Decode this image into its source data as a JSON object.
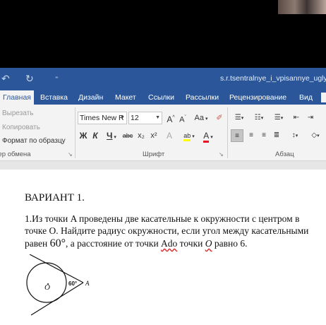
{
  "window": {
    "doc_title": "s.r.tsentralnye_i_vpisannye_ugly"
  },
  "tabs": [
    "Главная",
    "Вставка",
    "Дизайн",
    "Макет",
    "Ссылки",
    "Рассылки",
    "Рецензирование",
    "Вид"
  ],
  "clipboard": {
    "cut": "Вырезать",
    "copy": "Копировать",
    "format_painter": "Формат по образцу",
    "group_label": "Буфер обмена"
  },
  "font": {
    "name": "Times New R",
    "size": "12",
    "grow": "A",
    "shrink": "A",
    "case": "Aa",
    "bold": "Ж",
    "italic": "К",
    "underline": "Ч",
    "strike": "abc",
    "subscript": "x₂",
    "superscript": "x²",
    "text_effects": "A",
    "highlight": "ab",
    "font_color": "A",
    "group_label": "Шрифт"
  },
  "paragraph": {
    "group_label": "Абзац"
  },
  "colors": {
    "accent": "#2b579a",
    "highlight": "#ffff00",
    "font_color": "#e81123"
  },
  "document": {
    "variant": "ВАРИАНТ 1.",
    "problem_lines": [
      "1.Из точки A проведены две касательные к окружности с центром в",
      "точке O. Найдите радиус окружности, если угол между касательными"
    ],
    "line3_prefix": "равен ",
    "angle": "60°",
    "line3_mid1": ", а расстояние от точки ",
    "line3_A": "Ado",
    "line3_mid2": " точки ",
    "line3_O": "O",
    "line3_suffix": " равно 6.",
    "figure": {
      "center_label": "O",
      "point_label": "A",
      "angle_label": "60°"
    }
  }
}
